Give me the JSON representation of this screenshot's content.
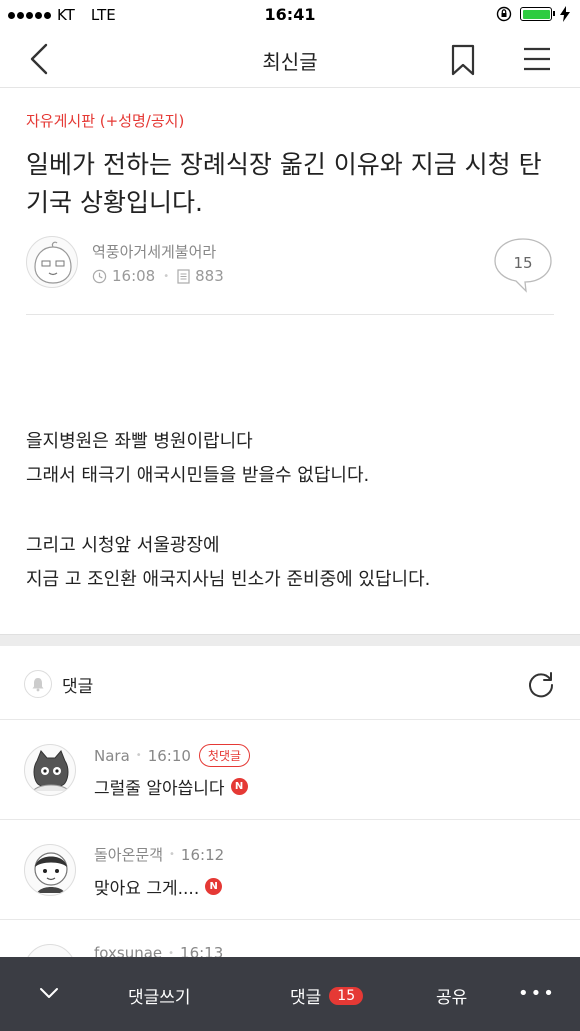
{
  "status_bar": {
    "carrier": "KT",
    "network": "LTE",
    "time": "16:41",
    "battery_level": 1.0,
    "battery_color": "#2ecc40"
  },
  "nav": {
    "title": "최신글",
    "back_icon": "chevron-left-icon",
    "bookmark_icon": "bookmark-icon",
    "menu_icon": "hamburger-menu-icon"
  },
  "post": {
    "category": "자유게시판 (+성명/공지)",
    "title": "일베가 전하는 장례식장 옮긴 이유와 지금 시청 탄기국 상황입니다.",
    "author": "역풍아거세게불어라",
    "time": "16:08",
    "views": "883",
    "comment_count": "15",
    "body_paragraphs": [
      [
        "을지병원은 좌빨 병원이랍니다",
        "그래서 태극기 애국시민들을 받을수 없답니다."
      ],
      [
        "그리고 시청앞 서울광장에",
        "지금 고 조인환 애국지사님 빈소가 준비중에 있답니다."
      ]
    ]
  },
  "comments_section": {
    "label": "댓글",
    "items": [
      {
        "author": "Nara",
        "time": "16:10",
        "badge": "첫댓글",
        "text": "그럴줄 알아씁니다",
        "new_mark": "N"
      },
      {
        "author": "돌아온문객",
        "time": "16:12",
        "badge": "",
        "text": "맞아요 그게....",
        "new_mark": "N"
      },
      {
        "author": "foxsunae",
        "time": "16:13",
        "badge": "",
        "text": "",
        "new_mark": ""
      }
    ]
  },
  "bottom_bar": {
    "write_label": "댓글쓰기",
    "comments_label": "댓글",
    "comments_count": "15",
    "share_label": "공유",
    "more_label": "•••"
  },
  "colors": {
    "accent_red": "#e53935",
    "bottom_bar_bg": "#3b3d44"
  }
}
